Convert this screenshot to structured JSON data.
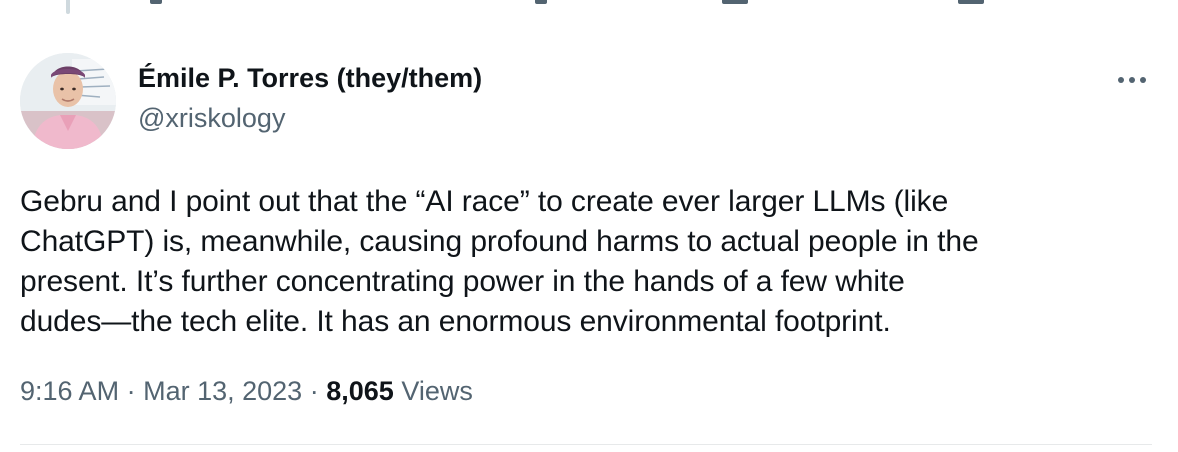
{
  "tweet": {
    "author": {
      "display_name": "Émile P. Torres (they/them)",
      "handle": "@xriskology"
    },
    "text": "Gebru and I point out that the “AI race” to create ever larger LLMs (like\nChatGPT) is, meanwhile, causing profound harms to actual people in the\npresent. It’s further concentrating power in the hands of a few white\ndudes—the tech elite. It has an enormous environmental footprint.",
    "meta": {
      "time": "9:16 AM",
      "separator": "·",
      "date": "Mar 13, 2023",
      "views_count": "8,065",
      "views_label": "Views"
    }
  },
  "icons": {
    "more": "more-horizontal-icon"
  },
  "colors": {
    "text_primary": "#0f1419",
    "text_secondary": "#536471",
    "divider": "#e7e9ea"
  }
}
